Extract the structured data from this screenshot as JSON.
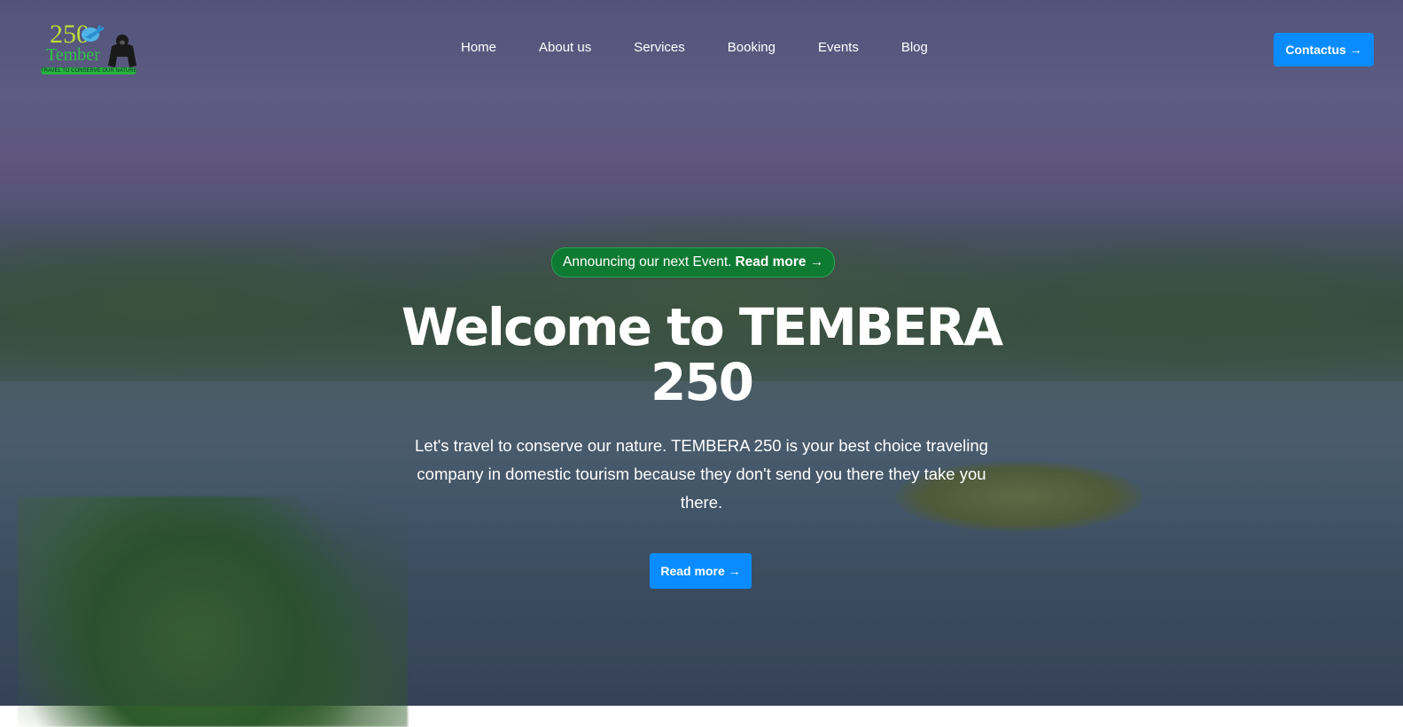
{
  "logo": {
    "number": "250",
    "name": "Tember",
    "tagline": "TRAVEL TO CONSERVE OUR NATURE"
  },
  "nav": {
    "items": [
      {
        "label": "Home"
      },
      {
        "label": "About us"
      },
      {
        "label": "Services"
      },
      {
        "label": "Booking"
      },
      {
        "label": "Events"
      },
      {
        "label": "Blog"
      }
    ]
  },
  "header": {
    "contact_label": "Contactus →"
  },
  "announcement": {
    "text": "Announcing our next Event.",
    "link_label": "Read more →",
    "color": "#0f7a32"
  },
  "hero": {
    "title": "Welcome to TEMBERA 250",
    "description": "Let's travel to conserve our nature. TEMBERA 250 is your best choice traveling company in domestic tourism because they don't send you there they take you there.",
    "cta_label": "Read more →"
  },
  "colors": {
    "accent": "#0a8cff"
  }
}
